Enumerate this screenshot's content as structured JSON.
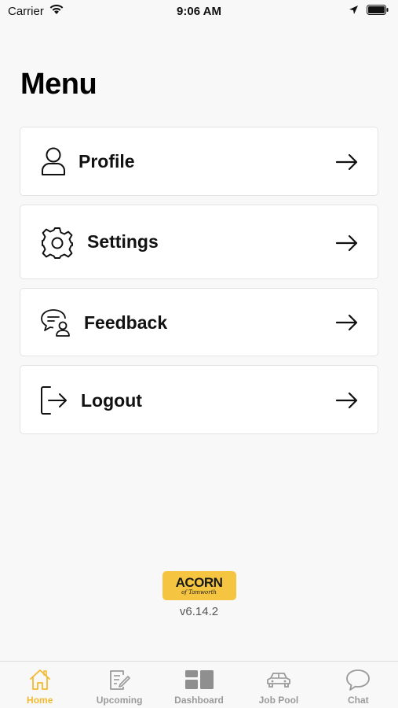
{
  "status_bar": {
    "carrier": "Carrier",
    "time": "9:06 AM"
  },
  "page": {
    "title": "Menu"
  },
  "menu": {
    "items": [
      {
        "label": "Profile",
        "icon": "person-icon"
      },
      {
        "label": "Settings",
        "icon": "gear-icon"
      },
      {
        "label": "Feedback",
        "icon": "feedback-icon"
      },
      {
        "label": "Logout",
        "icon": "logout-icon"
      }
    ]
  },
  "brand": {
    "logo_text": "ACORN",
    "logo_subtext": "of Tamworth",
    "version": "v6.14.2",
    "logo_color": "#f5c542"
  },
  "tab_bar": {
    "tabs": [
      {
        "label": "Home",
        "icon": "home-icon",
        "active": true
      },
      {
        "label": "Upcoming",
        "icon": "clipboard-icon",
        "active": false
      },
      {
        "label": "Dashboard",
        "icon": "dashboard-icon",
        "active": false
      },
      {
        "label": "Job Pool",
        "icon": "car-icon",
        "active": false
      },
      {
        "label": "Chat",
        "icon": "chat-icon",
        "active": false
      }
    ],
    "active_color": "#f3b92e",
    "inactive_color": "#9a9a9a"
  }
}
